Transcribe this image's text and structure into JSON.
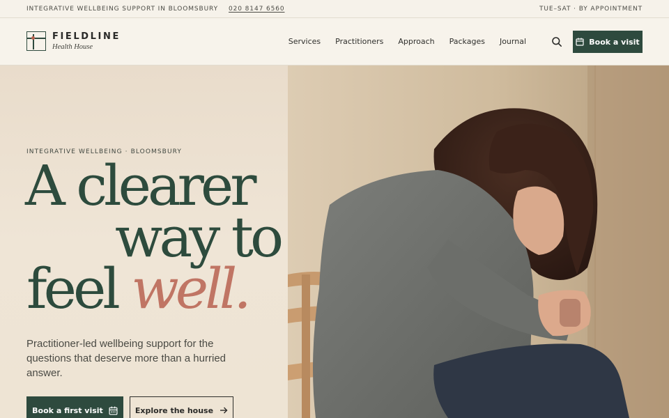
{
  "topbar": {
    "tagline": "INTEGRATIVE WELLBEING SUPPORT IN BLOOMSBURY",
    "phone": "020 8147 6560",
    "hours": "TUE–SAT · BY APPOINTMENT"
  },
  "brand": {
    "name": "FIELDLINE",
    "subtitle": "Health House"
  },
  "nav": {
    "items": [
      "Services",
      "Practitioners",
      "Approach",
      "Packages",
      "Journal"
    ],
    "search_icon": "search-icon",
    "book_label": "Book a visit",
    "book_icon": "calendar-icon"
  },
  "hero": {
    "eyebrow": "INTEGRATIVE WELLBEING · BLOOMSBURY",
    "headline_line1": "A clearer",
    "headline_line2": "way to",
    "headline_line3_plain": "feel",
    "headline_line3_accent": "well.",
    "lede": "Practitioner-led wellbeing support for the questions that deserve more than a hurried answer.",
    "primary_cta": "Book a first visit",
    "primary_cta_icon": "calendar-icon",
    "secondary_cta": "Explore the house",
    "secondary_cta_icon": "arrow-right-icon"
  },
  "colors": {
    "brand_green": "#2e4a3e",
    "accent_terracotta": "#c07564",
    "background": "#f6f2ea"
  }
}
